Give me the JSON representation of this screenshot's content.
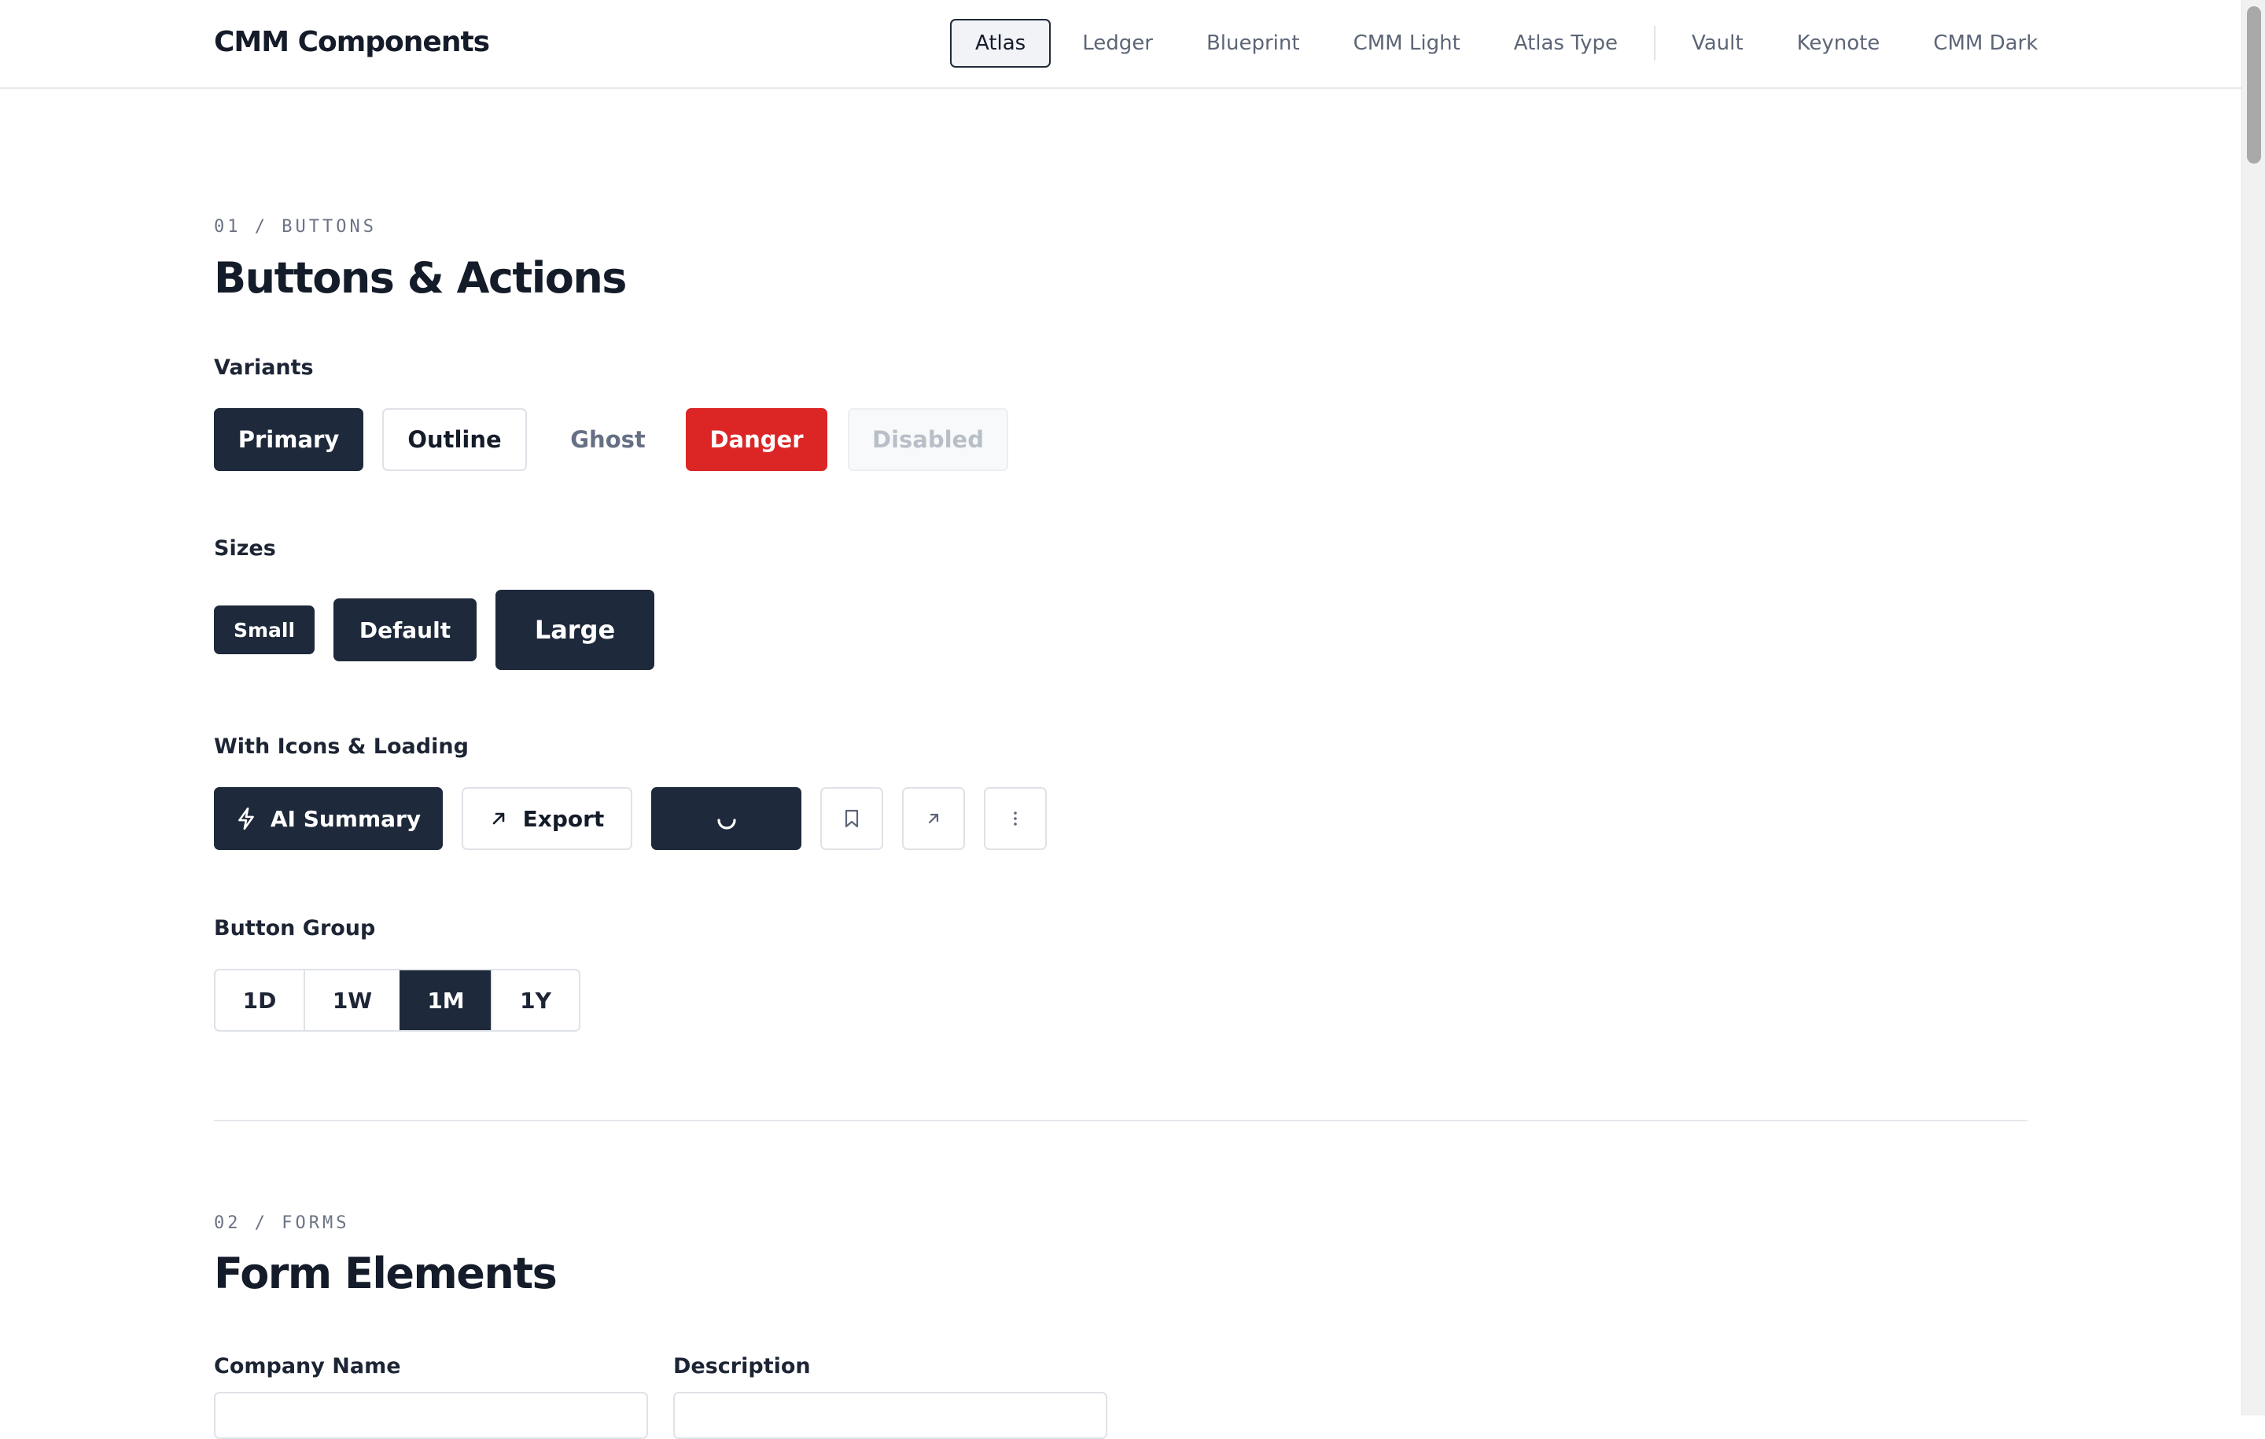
{
  "header": {
    "brand": "CMM Components",
    "nav": [
      {
        "label": "Atlas",
        "active": true
      },
      {
        "label": "Ledger"
      },
      {
        "label": "Blueprint"
      },
      {
        "label": "CMM Light"
      },
      {
        "label": "Atlas Type"
      },
      {
        "label": "Vault"
      },
      {
        "label": "Keynote"
      },
      {
        "label": "CMM Dark"
      }
    ]
  },
  "buttons_section": {
    "label": "01 / BUTTONS",
    "title": "Buttons & Actions",
    "variants": {
      "heading": "Variants",
      "primary": "Primary",
      "outline": "Outline",
      "ghost": "Ghost",
      "danger": "Danger",
      "disabled": "Disabled"
    },
    "sizes": {
      "heading": "Sizes",
      "small": "Small",
      "default": "Default",
      "large": "Large"
    },
    "icons": {
      "heading": "With Icons & Loading",
      "ai_summary": "AI Summary",
      "export": "Export"
    },
    "group": {
      "heading": "Button Group",
      "items": [
        "1D",
        "1W",
        "1M",
        "1Y"
      ],
      "selected": "1M"
    }
  },
  "forms_section": {
    "label": "02 / FORMS",
    "title": "Form Elements",
    "company_name_label": "Company Name",
    "description_label": "Description"
  },
  "colors": {
    "primary": "#1e293b",
    "danger": "#dc2626",
    "border": "#dfe2e7"
  }
}
